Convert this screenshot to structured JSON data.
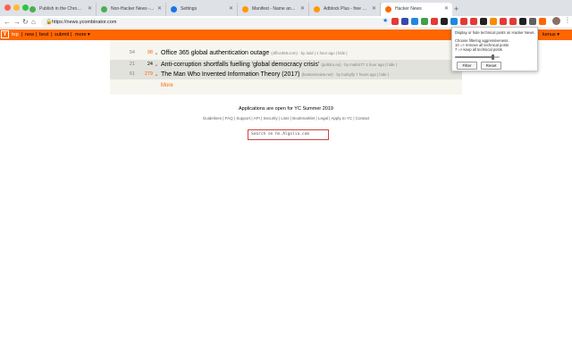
{
  "browser": {
    "tabs": [
      {
        "label": "Publish in the Chrome Web St",
        "favicon_color": "#4caf50"
      },
      {
        "label": "Non-Hacker News - Edit Item",
        "favicon_color": "#4caf50"
      },
      {
        "label": "Settings",
        "favicon_color": "#1a73e8"
      },
      {
        "label": "Manifest - Name and Short N",
        "favicon_color": "#ff9800"
      },
      {
        "label": "Adblock Plus - free ad blocker",
        "favicon_color": "#ff9800"
      },
      {
        "label": "Hacker News",
        "favicon_color": "#ff6600"
      }
    ],
    "new_tab": "+",
    "url": "https://news.ycombinator.com",
    "ext_colors": [
      "#e53935",
      "#3949ab",
      "#1e88e5",
      "#43a047",
      "#e53935",
      "#212121",
      "#1e88e5",
      "#e53935",
      "#e53935",
      "#212121",
      "#fb8c00",
      "#e53935",
      "#e53935",
      "#212121",
      "#616161",
      "#ff6600"
    ]
  },
  "hn": {
    "logo": "Y",
    "nav": {
      "top": "top",
      "new": "new",
      "best": "best",
      "submit": "submit",
      "more": "more ▾"
    },
    "seps": [
      "|",
      "|",
      "|",
      "|"
    ],
    "user": "kenus ▾",
    "stories": [
      {
        "rank": "54",
        "score": "98",
        "title": "Office 365 global authentication outage",
        "meta": "(office365.com) · by 3uid | 1 hour ago | hide |"
      },
      {
        "rank": "21",
        "score": "24",
        "title": "Anti-corruption shortfalls fuelling ‘global democracy crisis’",
        "meta": "(politico.eu) · by mattr477 1 hour ago | hide |"
      },
      {
        "rank": "61",
        "score": "279",
        "title": "The Man Who Invented Information Theory (2017)",
        "meta": "(bostonreview.net) · by hurbylly 7 hours ago | hide |"
      }
    ],
    "more": "More",
    "footer": {
      "yc": "Applications are open for YC Summer 2019",
      "links": "Guidelines | FAQ | Support | API | Security | Lists | Bookmarklet | Legal | Apply to YC | Contact",
      "search_placeholder": "Search on hn.Algolia.com"
    }
  },
  "popup": {
    "line1": "Display or hide technical posts on Hacker News.",
    "line2": "Choose filtering aggressiveness.",
    "line3": "10 => remove all technical posts",
    "line4": "7 => keep all technical posts",
    "slider_value": 0.85,
    "filter": "Filter",
    "reset": "Reset"
  }
}
